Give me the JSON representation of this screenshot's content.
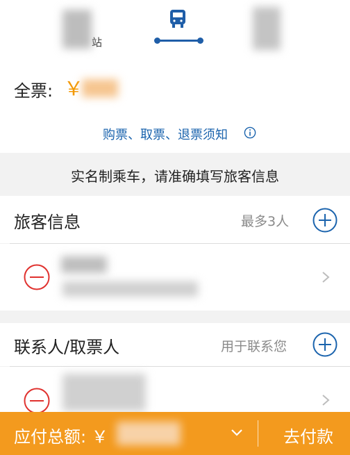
{
  "route": {
    "from_station_suffix": "站",
    "icon": "bus-icon"
  },
  "fare": {
    "label": "全票:",
    "currency": "￥"
  },
  "notice": {
    "link_text": "购票、取票、退票须知",
    "icon": "info-icon"
  },
  "banner": {
    "text": "实名制乘车，请准确填写旅客信息"
  },
  "passenger": {
    "title": "旅客信息",
    "hint": "最多3人",
    "add_icon": "plus-circle-icon",
    "remove_icon": "minus-circle-icon"
  },
  "contact": {
    "title": "联系人/取票人",
    "hint": "用于联系您",
    "add_icon": "plus-circle-icon",
    "remove_icon": "minus-circle-icon"
  },
  "paybar": {
    "label": "应付总额: ￥",
    "pay_button": "去付款",
    "expand_icon": "chevron-down-icon"
  },
  "colors": {
    "accent": "#f39800",
    "link": "#1a63ad",
    "route_line": "#1f5ea8",
    "remove": "#e0312e",
    "pay_bar": "#f39a1e"
  }
}
